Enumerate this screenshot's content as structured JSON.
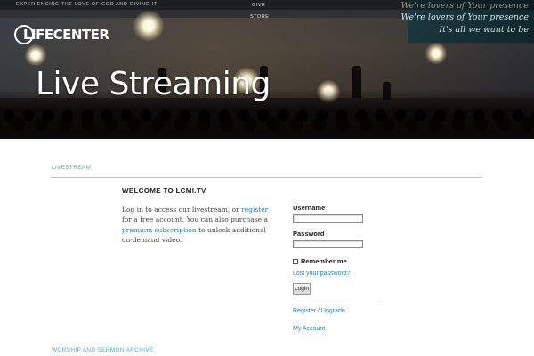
{
  "header": {
    "tagline": "EXPERIENCING THE LOVE OF GOD AND GIVING IT",
    "nav": [
      "GIVE",
      "STORE"
    ],
    "logo_text": "LIFECENTER",
    "title": "Live Streaming",
    "lyrics": [
      "We're lovers of Your presence",
      "We're lovers of Your presence",
      "It's all we want to be"
    ]
  },
  "breadcrumb": "LIVESTREAM",
  "welcome": {
    "heading": "WELCOME TO LCMI.TV",
    "text_1": "Log in to access our livestream, or ",
    "register_link": "register",
    "text_2": " for a free account. You can also purchase a ",
    "premium_link": "premium subscription",
    "text_3": " to unlock additional on-demand video."
  },
  "login": {
    "username_label": "Username",
    "username_value": "",
    "password_label": "Password",
    "password_value": "",
    "remember_label": "Remember me",
    "lost_password": "Lost your password?",
    "button": "Login",
    "register_upgrade": "Register / Upgrade",
    "my_account": "My Account"
  },
  "archive": "WORSHIP AND SERMON ARCHIVE"
}
